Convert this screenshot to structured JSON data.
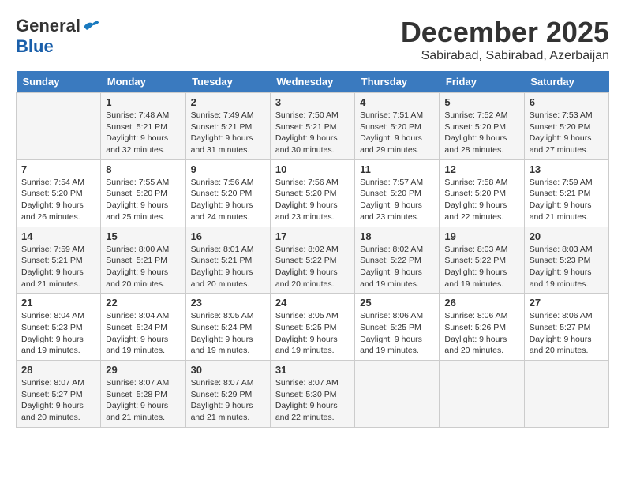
{
  "logo": {
    "general": "General",
    "blue": "Blue"
  },
  "title": {
    "month": "December 2025",
    "location": "Sabirabad, Sabirabad, Azerbaijan"
  },
  "headers": [
    "Sunday",
    "Monday",
    "Tuesday",
    "Wednesday",
    "Thursday",
    "Friday",
    "Saturday"
  ],
  "weeks": [
    [
      {
        "day": "",
        "info": ""
      },
      {
        "day": "1",
        "info": "Sunrise: 7:48 AM\nSunset: 5:21 PM\nDaylight: 9 hours\nand 32 minutes."
      },
      {
        "day": "2",
        "info": "Sunrise: 7:49 AM\nSunset: 5:21 PM\nDaylight: 9 hours\nand 31 minutes."
      },
      {
        "day": "3",
        "info": "Sunrise: 7:50 AM\nSunset: 5:21 PM\nDaylight: 9 hours\nand 30 minutes."
      },
      {
        "day": "4",
        "info": "Sunrise: 7:51 AM\nSunset: 5:20 PM\nDaylight: 9 hours\nand 29 minutes."
      },
      {
        "day": "5",
        "info": "Sunrise: 7:52 AM\nSunset: 5:20 PM\nDaylight: 9 hours\nand 28 minutes."
      },
      {
        "day": "6",
        "info": "Sunrise: 7:53 AM\nSunset: 5:20 PM\nDaylight: 9 hours\nand 27 minutes."
      }
    ],
    [
      {
        "day": "7",
        "info": "Sunrise: 7:54 AM\nSunset: 5:20 PM\nDaylight: 9 hours\nand 26 minutes."
      },
      {
        "day": "8",
        "info": "Sunrise: 7:55 AM\nSunset: 5:20 PM\nDaylight: 9 hours\nand 25 minutes."
      },
      {
        "day": "9",
        "info": "Sunrise: 7:56 AM\nSunset: 5:20 PM\nDaylight: 9 hours\nand 24 minutes."
      },
      {
        "day": "10",
        "info": "Sunrise: 7:56 AM\nSunset: 5:20 PM\nDaylight: 9 hours\nand 23 minutes."
      },
      {
        "day": "11",
        "info": "Sunrise: 7:57 AM\nSunset: 5:20 PM\nDaylight: 9 hours\nand 23 minutes."
      },
      {
        "day": "12",
        "info": "Sunrise: 7:58 AM\nSunset: 5:20 PM\nDaylight: 9 hours\nand 22 minutes."
      },
      {
        "day": "13",
        "info": "Sunrise: 7:59 AM\nSunset: 5:21 PM\nDaylight: 9 hours\nand 21 minutes."
      }
    ],
    [
      {
        "day": "14",
        "info": "Sunrise: 7:59 AM\nSunset: 5:21 PM\nDaylight: 9 hours\nand 21 minutes."
      },
      {
        "day": "15",
        "info": "Sunrise: 8:00 AM\nSunset: 5:21 PM\nDaylight: 9 hours\nand 20 minutes."
      },
      {
        "day": "16",
        "info": "Sunrise: 8:01 AM\nSunset: 5:21 PM\nDaylight: 9 hours\nand 20 minutes."
      },
      {
        "day": "17",
        "info": "Sunrise: 8:02 AM\nSunset: 5:22 PM\nDaylight: 9 hours\nand 20 minutes."
      },
      {
        "day": "18",
        "info": "Sunrise: 8:02 AM\nSunset: 5:22 PM\nDaylight: 9 hours\nand 19 minutes."
      },
      {
        "day": "19",
        "info": "Sunrise: 8:03 AM\nSunset: 5:22 PM\nDaylight: 9 hours\nand 19 minutes."
      },
      {
        "day": "20",
        "info": "Sunrise: 8:03 AM\nSunset: 5:23 PM\nDaylight: 9 hours\nand 19 minutes."
      }
    ],
    [
      {
        "day": "21",
        "info": "Sunrise: 8:04 AM\nSunset: 5:23 PM\nDaylight: 9 hours\nand 19 minutes."
      },
      {
        "day": "22",
        "info": "Sunrise: 8:04 AM\nSunset: 5:24 PM\nDaylight: 9 hours\nand 19 minutes."
      },
      {
        "day": "23",
        "info": "Sunrise: 8:05 AM\nSunset: 5:24 PM\nDaylight: 9 hours\nand 19 minutes."
      },
      {
        "day": "24",
        "info": "Sunrise: 8:05 AM\nSunset: 5:25 PM\nDaylight: 9 hours\nand 19 minutes."
      },
      {
        "day": "25",
        "info": "Sunrise: 8:06 AM\nSunset: 5:25 PM\nDaylight: 9 hours\nand 19 minutes."
      },
      {
        "day": "26",
        "info": "Sunrise: 8:06 AM\nSunset: 5:26 PM\nDaylight: 9 hours\nand 20 minutes."
      },
      {
        "day": "27",
        "info": "Sunrise: 8:06 AM\nSunset: 5:27 PM\nDaylight: 9 hours\nand 20 minutes."
      }
    ],
    [
      {
        "day": "28",
        "info": "Sunrise: 8:07 AM\nSunset: 5:27 PM\nDaylight: 9 hours\nand 20 minutes."
      },
      {
        "day": "29",
        "info": "Sunrise: 8:07 AM\nSunset: 5:28 PM\nDaylight: 9 hours\nand 21 minutes."
      },
      {
        "day": "30",
        "info": "Sunrise: 8:07 AM\nSunset: 5:29 PM\nDaylight: 9 hours\nand 21 minutes."
      },
      {
        "day": "31",
        "info": "Sunrise: 8:07 AM\nSunset: 5:30 PM\nDaylight: 9 hours\nand 22 minutes."
      },
      {
        "day": "",
        "info": ""
      },
      {
        "day": "",
        "info": ""
      },
      {
        "day": "",
        "info": ""
      }
    ]
  ]
}
